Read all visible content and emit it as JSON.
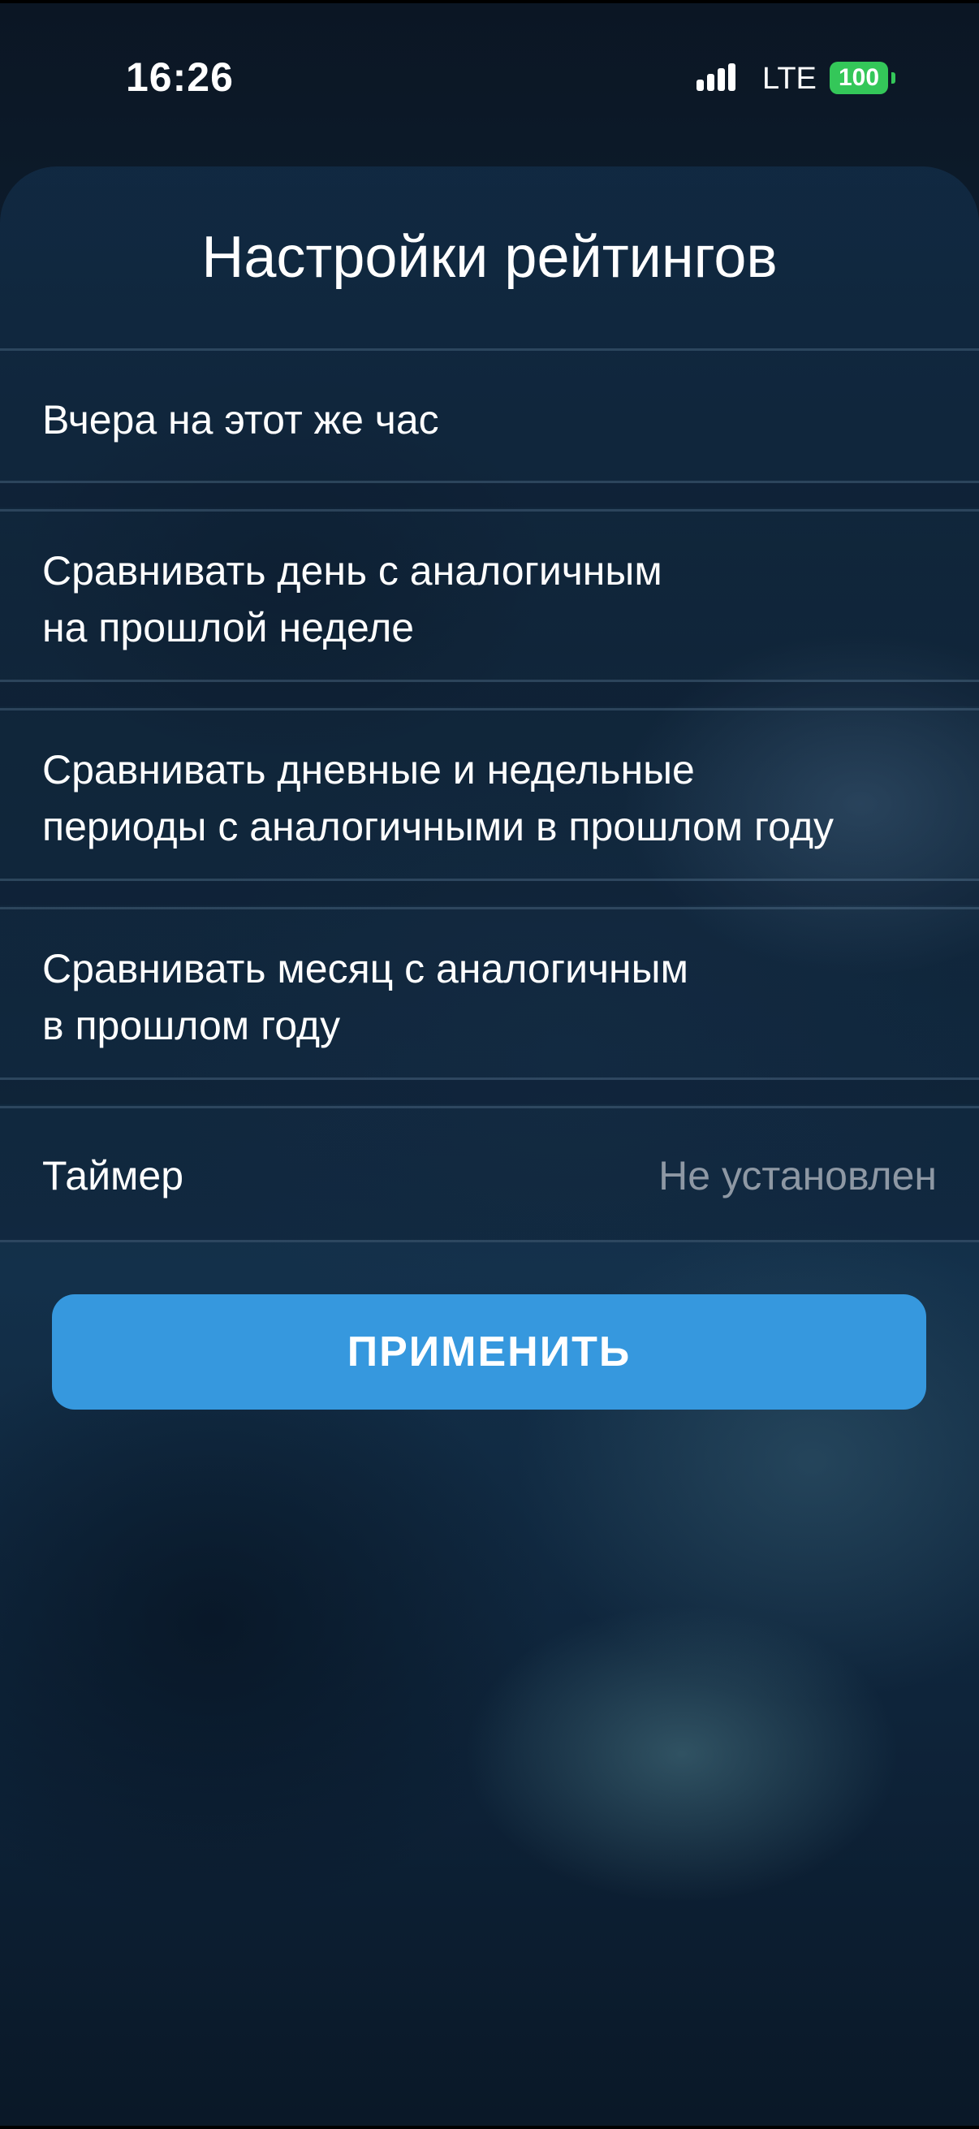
{
  "status_bar": {
    "time": "16:26",
    "network": "LTE",
    "battery": "100",
    "signal_icon": "signal-bars-icon"
  },
  "colors": {
    "accent": "#3698de",
    "battery": "#34c759",
    "secondary_text": "#8e98a4"
  },
  "settings": {
    "title": "Настройки рейтингов",
    "options": [
      {
        "lines": [
          "Вчера на этот же час"
        ]
      },
      {
        "lines": [
          "Сравнивать день с аналогичным",
          "на прошлой неделе"
        ]
      },
      {
        "lines": [
          "Сравнивать дневные и недельные",
          "периоды с аналогичными в прошлом году"
        ]
      },
      {
        "lines": [
          "Сравнивать месяц с аналогичным",
          "в прошлом году"
        ]
      }
    ],
    "timer": {
      "label": "Таймер",
      "value": "Не установлен"
    },
    "apply_label": "ПРИМЕНИТЬ"
  }
}
